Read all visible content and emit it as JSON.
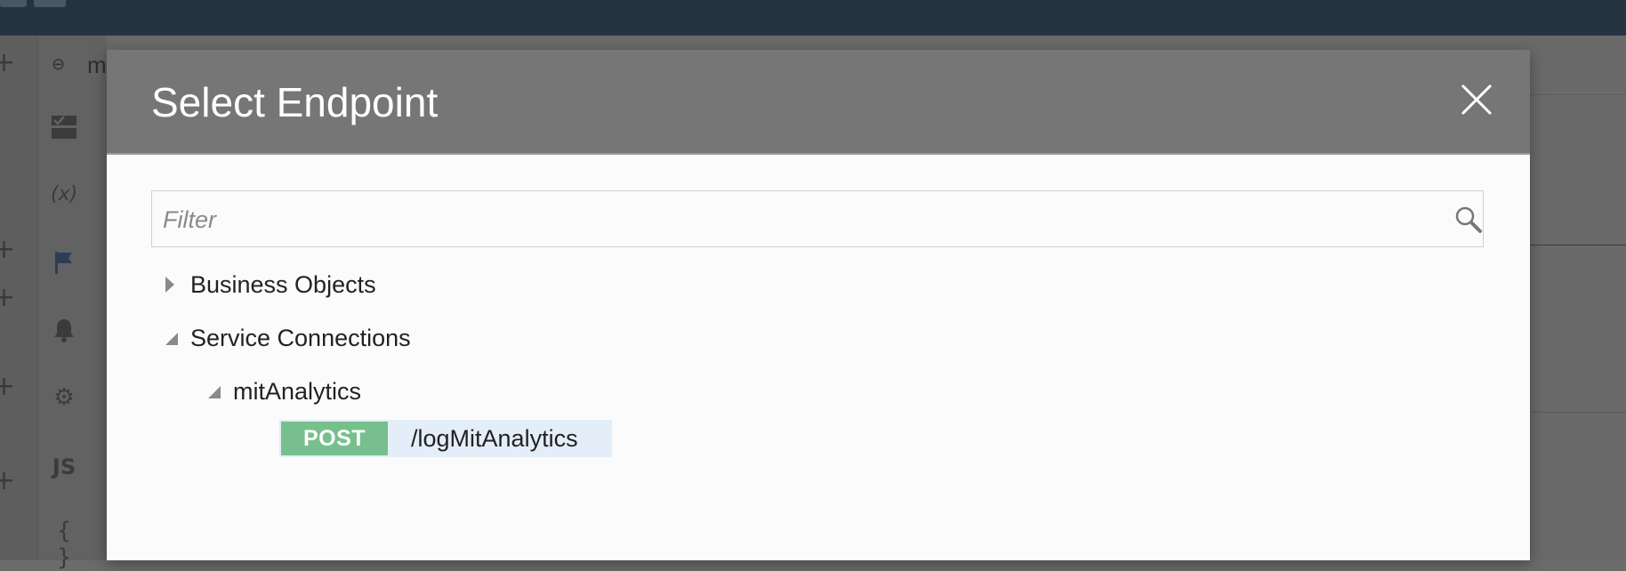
{
  "dialog": {
    "title": "Select Endpoint",
    "close_icon": "close-icon",
    "filter": {
      "placeholder": "Filter",
      "value": "",
      "icon": "search-icon"
    }
  },
  "tree": {
    "business_objects": {
      "label": "Business Objects",
      "expanded": false
    },
    "service_connections": {
      "label": "Service Connections",
      "expanded": true,
      "children": {
        "mit_analytics": {
          "label": "mitAnalytics",
          "expanded": true,
          "endpoints": [
            {
              "method": "POST",
              "path": "/logMitAnalytics",
              "selected": true
            }
          ]
        }
      }
    }
  },
  "background": {
    "tab_label": "m",
    "sidebar_icons": [
      "checklist-icon",
      "variable-icon",
      "flag-icon",
      "bell-icon",
      "gear-icon",
      "js-icon",
      "braces-icon"
    ],
    "sidebar_text": {
      "variable": "(x)",
      "js": "JS",
      "braces": "{ }"
    }
  },
  "colors": {
    "topbar": "#263442",
    "header": "#767676",
    "post_badge": "#77c08d",
    "endpoint_highlight": "#e3eef8"
  }
}
